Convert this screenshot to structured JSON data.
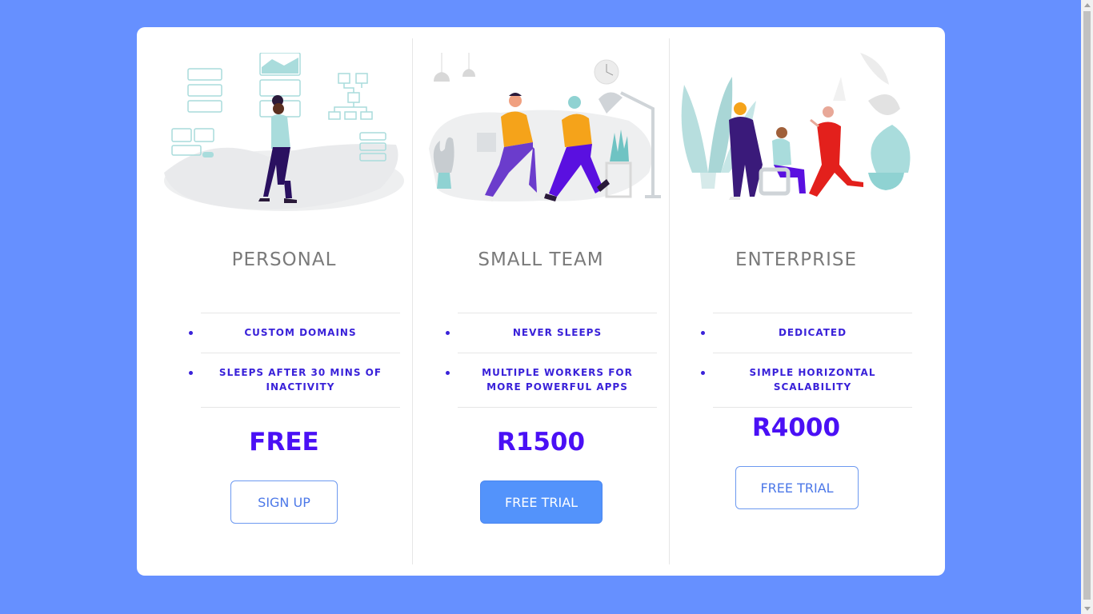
{
  "plans": [
    {
      "name": "PERSONAL",
      "features": [
        "CUSTOM DOMAINS",
        "SLEEPS AFTER 30 MINS OF INACTIVITY"
      ],
      "price": "FREE",
      "button": "SIGN UP"
    },
    {
      "name": "SMALL TEAM",
      "features": [
        "NEVER SLEEPS",
        "MULTIPLE WORKERS FOR MORE POWERFUL APPS"
      ],
      "price": "R1500",
      "button": "FREE TRIAL"
    },
    {
      "name": "ENTERPRISE",
      "features": [
        "DEDICATED",
        "SIMPLE HORIZONTAL SCALABILITY"
      ],
      "price": "R4000",
      "button": "FREE TRIAL"
    }
  ],
  "colors": {
    "background": "#6690ff",
    "card": "#ffffff",
    "title": "#7a7a7a",
    "feature_text": "#3a22d9",
    "price": "#4a10f5",
    "button_primary": "#5393fb",
    "button_outline": "#6d99f0"
  },
  "icons": {
    "personal": "personal-illustration",
    "team": "team-illustration",
    "enterprise": "enterprise-illustration"
  }
}
